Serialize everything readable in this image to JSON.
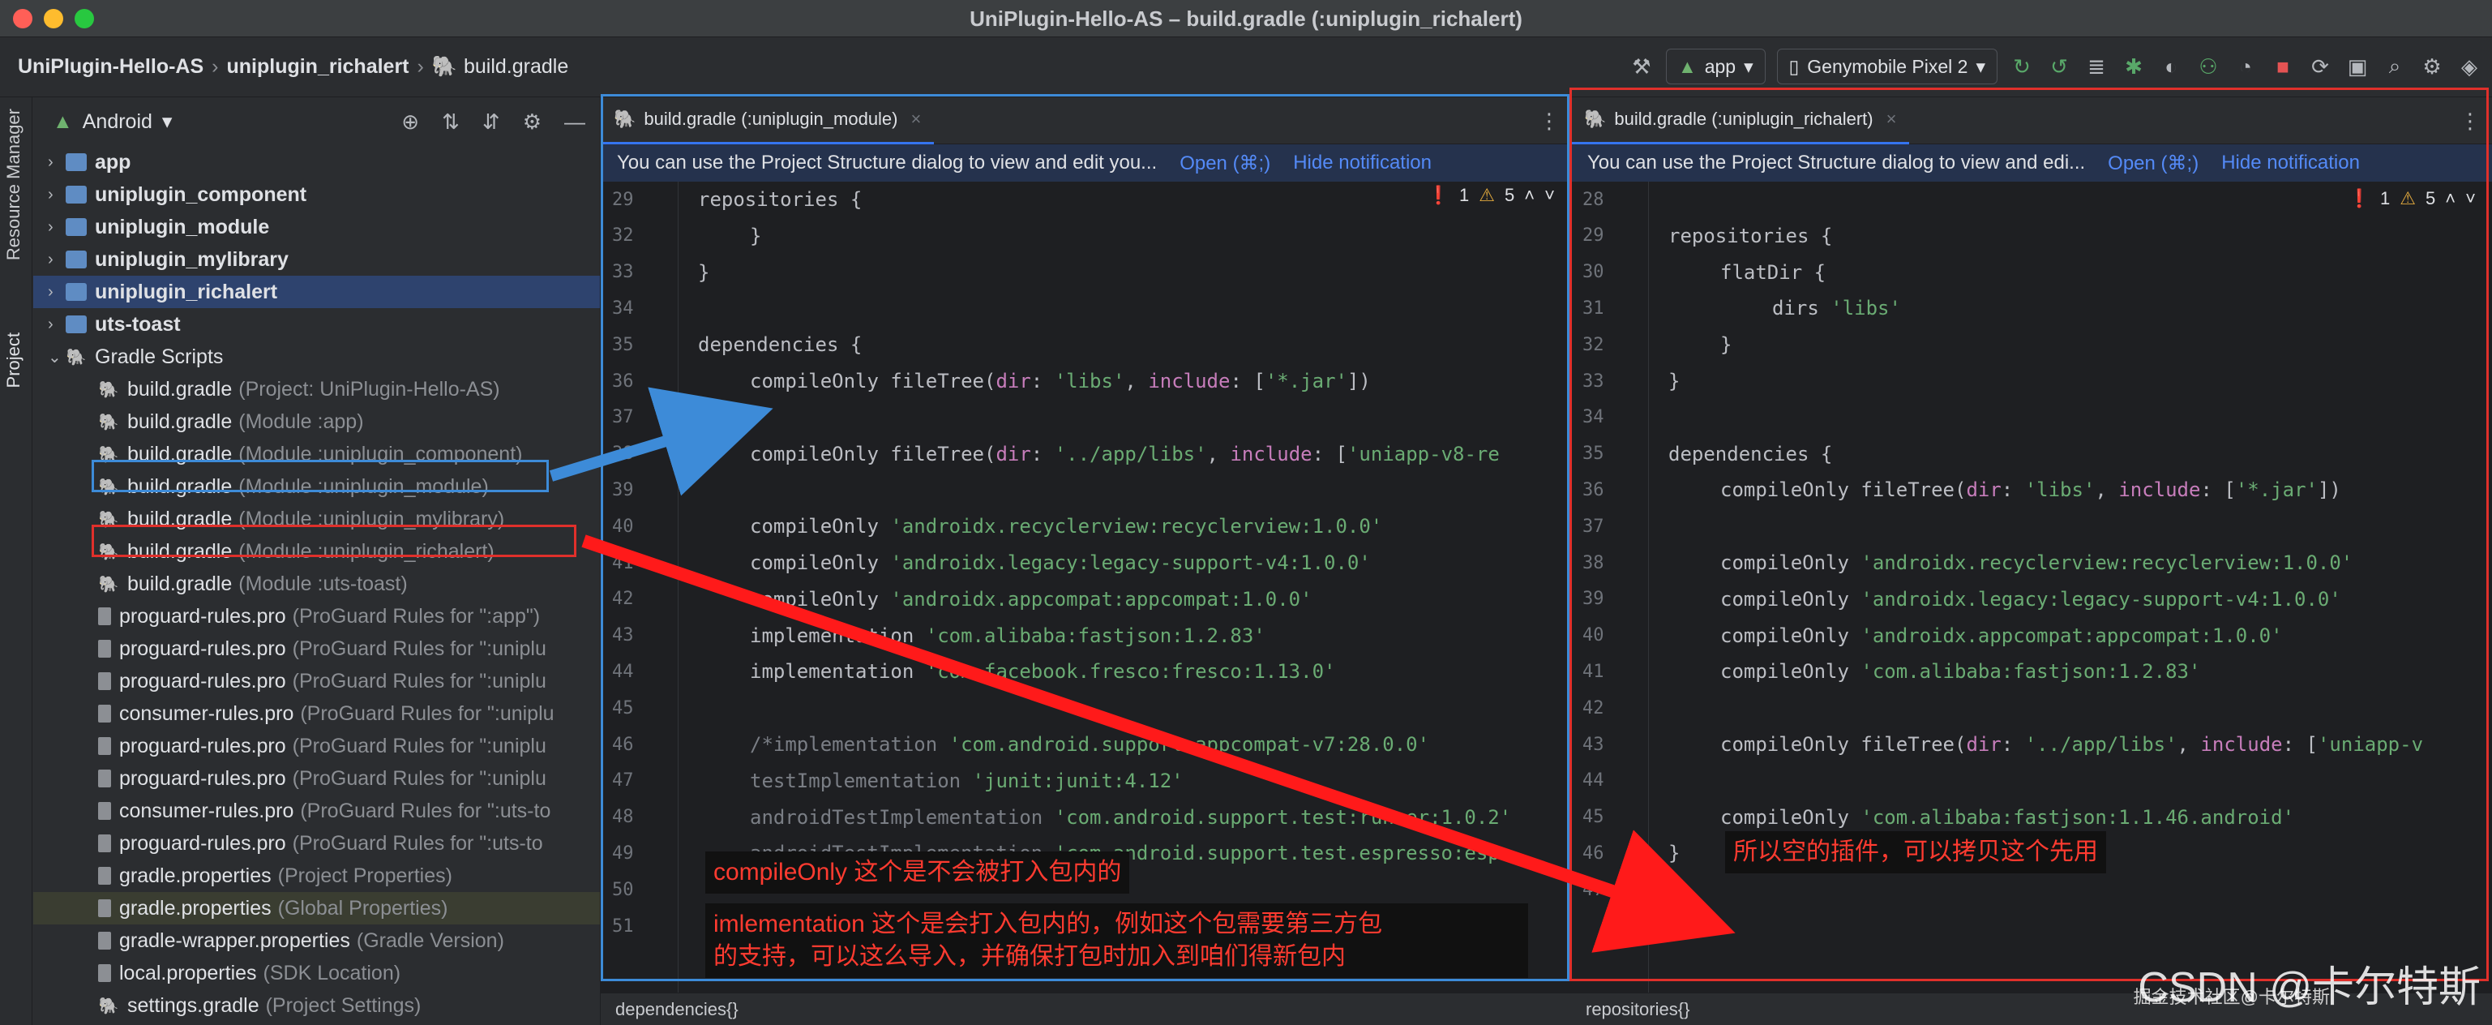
{
  "window": {
    "title": "UniPlugin-Hello-AS – build.gradle (:uniplugin_richalert)"
  },
  "navbar": {
    "crumbs": [
      "UniPlugin-Hello-AS",
      "uniplugin_richalert",
      "build.gradle"
    ],
    "run_config": "app",
    "device": "Genymobile Pixel 2"
  },
  "toolstrip": {
    "resource_manager": "Resource Manager",
    "project": "Project"
  },
  "project": {
    "view_label": "Android",
    "tree": [
      {
        "name": "app",
        "hint": "",
        "kind": "folder",
        "bold": true,
        "caret": "›"
      },
      {
        "name": "uniplugin_component",
        "hint": "",
        "kind": "folder",
        "bold": true,
        "caret": "›"
      },
      {
        "name": "uniplugin_module",
        "hint": "",
        "kind": "folder",
        "bold": true,
        "caret": "›"
      },
      {
        "name": "uniplugin_mylibrary",
        "hint": "",
        "kind": "folder",
        "bold": true,
        "caret": "›"
      },
      {
        "name": "uniplugin_richalert",
        "hint": "",
        "kind": "folder",
        "bold": true,
        "caret": "›",
        "selected": true
      },
      {
        "name": "uts-toast",
        "hint": "",
        "kind": "folder",
        "bold": true,
        "caret": "›"
      },
      {
        "name": "Gradle Scripts",
        "hint": "",
        "kind": "gradle",
        "bold": false,
        "caret": "⌄"
      },
      {
        "name": "build.gradle",
        "hint": "(Project: UniPlugin-Hello-AS)",
        "kind": "gradle",
        "indent": true
      },
      {
        "name": "build.gradle",
        "hint": "(Module :app)",
        "kind": "gradle",
        "indent": true
      },
      {
        "name": "build.gradle",
        "hint": "(Module :uniplugin_component)",
        "kind": "gradle",
        "indent": true
      },
      {
        "name": "build.gradle",
        "hint": "(Module :uniplugin_module)",
        "kind": "gradle",
        "indent": true
      },
      {
        "name": "build.gradle",
        "hint": "(Module :uniplugin_mylibrary)",
        "kind": "gradle",
        "indent": true
      },
      {
        "name": "build.gradle",
        "hint": "(Module :uniplugin_richalert)",
        "kind": "gradle",
        "indent": true
      },
      {
        "name": "build.gradle",
        "hint": "(Module :uts-toast)",
        "kind": "gradle",
        "indent": true
      },
      {
        "name": "proguard-rules.pro",
        "hint": "(ProGuard Rules for \":app\")",
        "kind": "file",
        "indent": true
      },
      {
        "name": "proguard-rules.pro",
        "hint": "(ProGuard Rules for \":uniplu",
        "kind": "file",
        "indent": true
      },
      {
        "name": "proguard-rules.pro",
        "hint": "(ProGuard Rules for \":uniplu",
        "kind": "file",
        "indent": true
      },
      {
        "name": "consumer-rules.pro",
        "hint": "(ProGuard Rules for \":uniplu",
        "kind": "file",
        "indent": true
      },
      {
        "name": "proguard-rules.pro",
        "hint": "(ProGuard Rules for \":uniplu",
        "kind": "file",
        "indent": true
      },
      {
        "name": "proguard-rules.pro",
        "hint": "(ProGuard Rules for \":uniplu",
        "kind": "file",
        "indent": true
      },
      {
        "name": "consumer-rules.pro",
        "hint": "(ProGuard Rules for \":uts-to",
        "kind": "file",
        "indent": true
      },
      {
        "name": "proguard-rules.pro",
        "hint": "(ProGuard Rules for \":uts-to",
        "kind": "file",
        "indent": true
      },
      {
        "name": "gradle.properties",
        "hint": "(Project Properties)",
        "kind": "file",
        "indent": true
      },
      {
        "name": "gradle.properties",
        "hint": "(Global Properties)",
        "kind": "file",
        "indent": true,
        "hover": true
      },
      {
        "name": "gradle-wrapper.properties",
        "hint": "(Gradle Version)",
        "kind": "file",
        "indent": true
      },
      {
        "name": "local.properties",
        "hint": "(SDK Location)",
        "kind": "file",
        "indent": true
      },
      {
        "name": "settings.gradle",
        "hint": "(Project Settings)",
        "kind": "gradle",
        "indent": true
      }
    ]
  },
  "left_editor": {
    "tab": "build.gradle (:uniplugin_module)",
    "notification": "You can use the Project Structure dialog to view and edit you...",
    "open_link": "Open (⌘;)",
    "hide_link": "Hide notification",
    "errors": "1",
    "warnings": "5",
    "status": "dependencies{}",
    "lines": [
      {
        "n": "29",
        "code": "repositories {",
        "ind": 0
      },
      {
        "n": "32",
        "code": "}",
        "ind": 1
      },
      {
        "n": "33",
        "code": "}",
        "ind": 0
      },
      {
        "n": "34",
        "code": "",
        "ind": 0
      },
      {
        "n": "35",
        "code": "dependencies {",
        "ind": 0
      },
      {
        "n": "36",
        "code": "compileOnly fileTree(dir: 'libs', include: ['*.jar'])",
        "ind": 1
      },
      {
        "n": "37",
        "code": "",
        "ind": 0
      },
      {
        "n": "38",
        "code": "compileOnly fileTree(dir: '../app/libs', include: ['uniapp-v8-re",
        "ind": 1
      },
      {
        "n": "39",
        "code": "",
        "ind": 0
      },
      {
        "n": "40",
        "code": "compileOnly 'androidx.recyclerview:recyclerview:1.0.0'",
        "ind": 1
      },
      {
        "n": "41",
        "code": "compileOnly 'androidx.legacy:legacy-support-v4:1.0.0'",
        "ind": 1
      },
      {
        "n": "42",
        "code": "compileOnly 'androidx.appcompat:appcompat:1.0.0'",
        "ind": 1
      },
      {
        "n": "43",
        "code": "implementation 'com.alibaba:fastjson:1.2.83'",
        "ind": 1
      },
      {
        "n": "44",
        "code": "implementation 'com.facebook.fresco:fresco:1.13.0'",
        "ind": 1
      },
      {
        "n": "45",
        "code": "",
        "ind": 0
      },
      {
        "n": "46",
        "code": "/*implementation 'com.android.support:appcompat-v7:28.0.0'",
        "ind": 1
      },
      {
        "n": "47",
        "code": "testImplementation 'junit:junit:4.12'",
        "ind": 1
      },
      {
        "n": "48",
        "code": "androidTestImplementation 'com.android.support.test:runner:1.0.2'",
        "ind": 1
      },
      {
        "n": "49",
        "code": "androidTestImplementation 'com.android.support.test.espresso:esp",
        "ind": 1
      },
      {
        "n": "50",
        "code": "",
        "ind": 0
      },
      {
        "n": "51",
        "code": "",
        "ind": 0
      }
    ]
  },
  "right_editor": {
    "tab": "build.gradle (:uniplugin_richalert)",
    "notification": "You can use the Project Structure dialog to view and edi...",
    "open_link": "Open (⌘;)",
    "hide_link": "Hide notification",
    "errors": "1",
    "warnings": "5",
    "status": "repositories{}",
    "lines": [
      {
        "n": "28",
        "code": "",
        "ind": 0
      },
      {
        "n": "29",
        "code": "repositories {",
        "ind": 0
      },
      {
        "n": "30",
        "code": "flatDir {",
        "ind": 1
      },
      {
        "n": "31",
        "code": "dirs 'libs'",
        "ind": 2
      },
      {
        "n": "32",
        "code": "}",
        "ind": 1
      },
      {
        "n": "33",
        "code": "}",
        "ind": 0
      },
      {
        "n": "34",
        "code": "",
        "ind": 0
      },
      {
        "n": "35",
        "code": "dependencies {",
        "ind": 0
      },
      {
        "n": "36",
        "code": "compileOnly fileTree(dir: 'libs', include: ['*.jar'])",
        "ind": 1
      },
      {
        "n": "37",
        "code": "",
        "ind": 0
      },
      {
        "n": "38",
        "code": "compileOnly 'androidx.recyclerview:recyclerview:1.0.0'",
        "ind": 1
      },
      {
        "n": "39",
        "code": "compileOnly 'androidx.legacy:legacy-support-v4:1.0.0'",
        "ind": 1
      },
      {
        "n": "40",
        "code": "compileOnly 'androidx.appcompat:appcompat:1.0.0'",
        "ind": 1
      },
      {
        "n": "41",
        "code": "compileOnly 'com.alibaba:fastjson:1.2.83'",
        "ind": 1
      },
      {
        "n": "42",
        "code": "",
        "ind": 0
      },
      {
        "n": "43",
        "code": "compileOnly fileTree(dir: '../app/libs', include: ['uniapp-v",
        "ind": 1
      },
      {
        "n": "44",
        "code": "",
        "ind": 0
      },
      {
        "n": "45",
        "code": "compileOnly 'com.alibaba:fastjson:1.1.46.android'",
        "ind": 1
      },
      {
        "n": "46",
        "code": "}",
        "ind": 0
      },
      {
        "n": "47",
        "code": "",
        "ind": 0
      }
    ]
  },
  "annotations": {
    "compile_only_note": "compileOnly 这个是不会被打入包内的",
    "implementation_note_1": "imlementation 这个是会打入包内的，例如这个包需要第三方包",
    "implementation_note_2": "的支持，可以这么导入，并确保打包时加入到咱们得新包内",
    "right_note": "所以空的插件，可以拷贝这个先用",
    "watermark": "CSDN @卡尔特斯",
    "watermark_small": "掘金技术社区@卡尔特斯"
  }
}
